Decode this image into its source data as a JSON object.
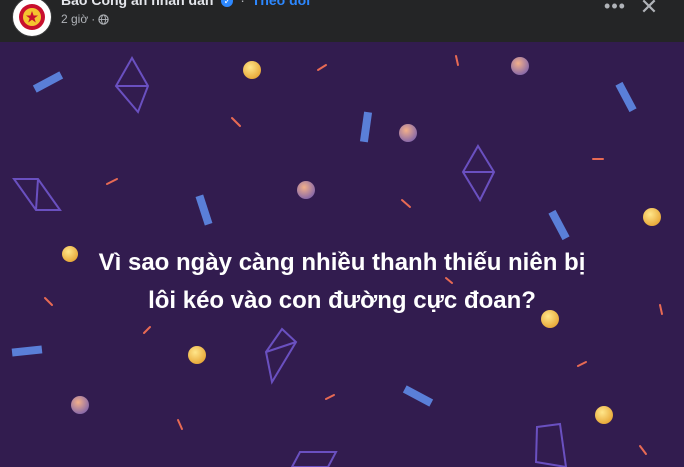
{
  "header": {
    "page_name": "Báo Công an nhân dân",
    "separator": "·",
    "follow_label": "Theo dõi",
    "time": "2 giờ",
    "privacy_icon": "globe-icon",
    "more_icon": "more-horizontal-icon",
    "more_label": "•••",
    "close_icon": "close-icon",
    "close_label": "✕"
  },
  "post": {
    "headline_line1": "Vì sao ngày càng nhiều thanh thiếu niên bị",
    "headline_line2": "lôi kéo vào con đường cực đoan?",
    "background_color": "#321c4f"
  },
  "colors": {
    "accent": "#2d88ff",
    "header_bg": "#242526"
  }
}
